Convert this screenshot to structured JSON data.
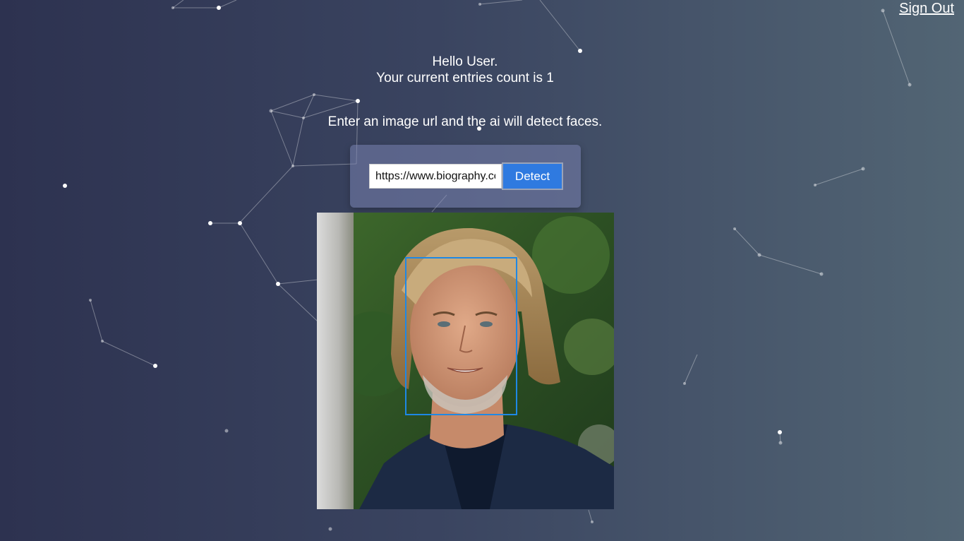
{
  "nav": {
    "sign_out_label": "Sign Out"
  },
  "rank": {
    "greeting": "Hello User.",
    "entries_text": "Your current entries count is 1"
  },
  "instructions": {
    "text": "Enter an image url and the ai will detect faces."
  },
  "image_form": {
    "url_value": "https://www.biography.com",
    "detect_label": "Detect"
  },
  "face_recognition": {
    "faces_detected": 1
  },
  "colors": {
    "accent": "#2f7ae0",
    "face_box": "#1e88e5",
    "background_left": "#2d3250",
    "background_right": "#526574"
  }
}
